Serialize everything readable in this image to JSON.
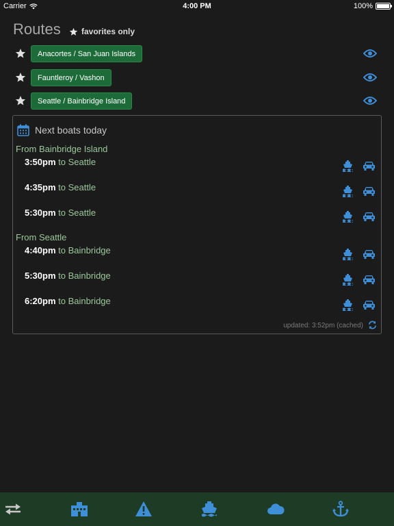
{
  "status_bar": {
    "carrier": "Carrier",
    "time": "4:00 PM",
    "battery": "100%"
  },
  "header": {
    "title": "Routes",
    "favorites_label": "favorites only"
  },
  "routes": [
    {
      "name": "Anacortes / San Juan Islands"
    },
    {
      "name": "Fauntleroy / Vashon"
    },
    {
      "name": "Seattle / Bainbridge Island"
    }
  ],
  "schedule": {
    "title": "Next boats today",
    "sections": [
      {
        "label": "From Bainbridge Island",
        "sailings": [
          {
            "time": "3:50pm",
            "dest": " to Seattle"
          },
          {
            "time": "4:35pm",
            "dest": " to Seattle"
          },
          {
            "time": "5:30pm",
            "dest": " to Seattle"
          }
        ]
      },
      {
        "label": "From Seattle",
        "sailings": [
          {
            "time": "4:40pm",
            "dest": " to Bainbridge"
          },
          {
            "time": "5:30pm",
            "dest": " to Bainbridge"
          },
          {
            "time": "6:20pm",
            "dest": " to Bainbridge"
          }
        ]
      }
    ],
    "updated": "updated: 3:52pm (cached)"
  },
  "tabbar": {
    "icons": [
      "swap-arrows-icon",
      "terminal-icon",
      "alert-icon",
      "ferry-icon",
      "weather-icon",
      "anchor-icon"
    ]
  },
  "colors": {
    "accent": "#4a90d9",
    "chip_bg": "#1d6b39",
    "section_text": "#9bc79b",
    "tabbar_bg": "#1e3b26"
  }
}
